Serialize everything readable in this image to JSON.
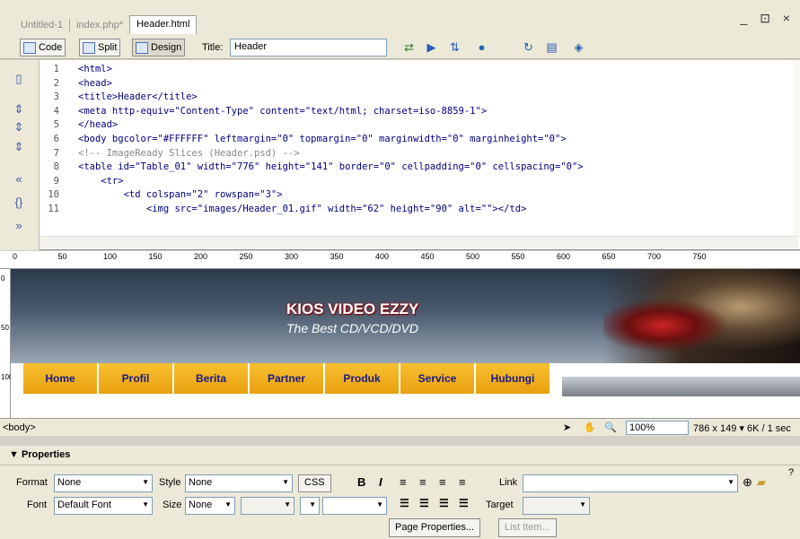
{
  "doc_tabs": [
    "Untitled-1",
    "index.php*",
    "Header.html"
  ],
  "window_controls": "_ ⊡ ×",
  "toolbar": {
    "code_label": "Code",
    "split_label": "Split",
    "design_label": "Design",
    "title_label": "Title:",
    "title_value": "Header"
  },
  "code_lines": [
    {
      "n": "1",
      "t": "<html>"
    },
    {
      "n": "2",
      "t": "<head>"
    },
    {
      "n": "3",
      "t": "<title>Header</title>"
    },
    {
      "n": "4",
      "t": "<meta http-equiv=\"Content-Type\" content=\"text/html; charset=iso-8859-1\">"
    },
    {
      "n": "5",
      "t": "</head>"
    },
    {
      "n": "6",
      "t": "<body bgcolor=\"#FFFFFF\" leftmargin=\"0\" topmargin=\"0\" marginwidth=\"0\" marginheight=\"0\">"
    },
    {
      "n": "7",
      "t": "<!-- ImageReady Slices (Header.psd) -->"
    },
    {
      "n": "8",
      "t": "<table id=\"Table_01\" width=\"776\" height=\"141\" border=\"0\" cellpadding=\"0\" cellspacing=\"0\">"
    },
    {
      "n": "9",
      "t": "    <tr>"
    },
    {
      "n": "10",
      "t": "        <td colspan=\"2\" rowspan=\"3\">"
    },
    {
      "n": "11",
      "t": "            <img src=\"images/Header_01.gif\" width=\"62\" height=\"90\" alt=\"\"></td>"
    }
  ],
  "ruler_marks": [
    "0",
    "50",
    "100",
    "150",
    "200",
    "250",
    "300",
    "350",
    "400",
    "450",
    "500",
    "550",
    "600",
    "650",
    "700",
    "750"
  ],
  "ruler_left_marks": [
    "0",
    "50",
    "100"
  ],
  "banner": {
    "title": "KIOS VIDEO EZZY",
    "tagline": "The Best CD/VCD/DVD"
  },
  "nav": [
    "Home",
    "Profil",
    "Berita",
    "Partner",
    "Produk",
    "Service",
    "Hubungi"
  ],
  "status": {
    "tag_selector": "<body>",
    "zoom": "100%",
    "dims": "786 x 149 ▾  6K / 1 sec"
  },
  "properties": {
    "header": "▼ Properties",
    "format_label": "Format",
    "format_value": "None",
    "style_label": "Style",
    "style_value": "None",
    "css_label": "CSS",
    "link_label": "Link",
    "font_label": "Font",
    "font_value": "Default Font",
    "size_label": "Size",
    "size_value": "None",
    "target_label": "Target",
    "page_props_label": "Page Properties...",
    "list_item_label": "List Item..."
  }
}
